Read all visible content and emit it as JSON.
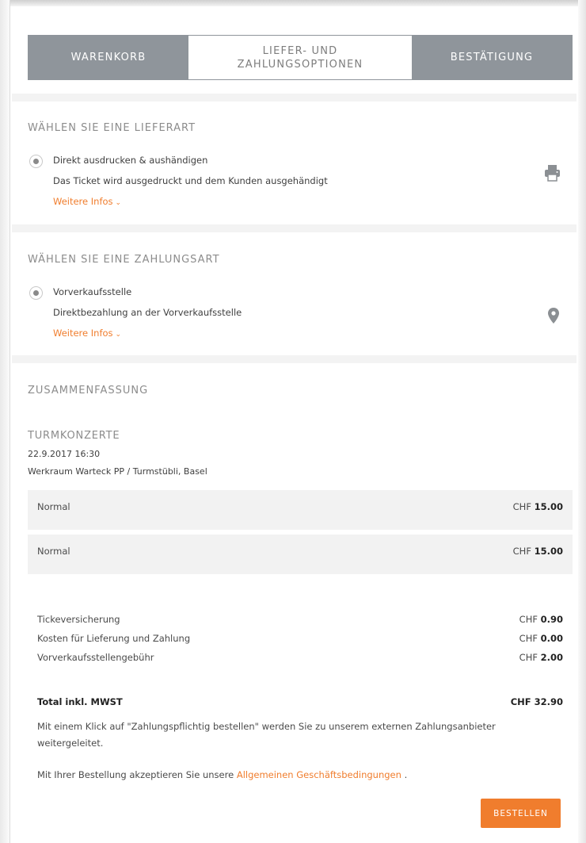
{
  "stepper": {
    "steps": [
      {
        "label": "WARENKORB",
        "active": false
      },
      {
        "label": "LIEFER- UND ZAHLUNGSOPTIONEN",
        "active": true
      },
      {
        "label": "BESTÄTIGUNG",
        "active": false
      }
    ]
  },
  "delivery": {
    "title": "WÄHLEN SIE EINE LIEFERART",
    "option_title": "Direkt ausdrucken & aushändigen",
    "option_desc": "Das Ticket wird ausgedruckt und dem Kunden ausgehändigt",
    "more_info": "Weitere Infos",
    "icon": "printer-icon"
  },
  "payment": {
    "title": "WÄHLEN SIE EINE ZAHLUNGSART",
    "option_title": "Vorverkaufsstelle",
    "option_desc": "Direktbezahlung an der Vorverkaufsstelle",
    "more_info": "Weitere Infos",
    "icon": "map-pin-icon"
  },
  "summary": {
    "title": "ZUSAMMENFASSUNG",
    "event": {
      "name": "TURMKONZERTE",
      "datetime": "22.9.2017 16:30",
      "venue": "Werkraum Warteck PP / Turmstübli, Basel"
    },
    "tickets": [
      {
        "label": "Normal",
        "currency": "CHF",
        "amount": "15.00"
      },
      {
        "label": "Normal",
        "currency": "CHF",
        "amount": "15.00"
      }
    ],
    "fees": [
      {
        "label": "Tickeversicherung",
        "currency": "CHF",
        "amount": "0.90"
      },
      {
        "label": "Kosten für Lieferung und Zahlung",
        "currency": "CHF",
        "amount": "0.00"
      },
      {
        "label": "Vorverkaufsstellengebühr",
        "currency": "CHF",
        "amount": "2.00"
      }
    ],
    "total": {
      "label": "Total inkl. MWST",
      "value": "CHF 32.90"
    },
    "redirect_note": "Mit einem Klick auf \"Zahlungspflichtig bestellen\" werden Sie zu unserem externen Zahlungsanbieter weitergeleitet.",
    "terms_prefix": "Mit Ihrer Bestellung akzeptieren Sie unsere",
    "terms_link": "Allgemeinen Geschäftsbedingungen",
    "terms_suffix": " ."
  },
  "order_button": "BESTELLEN",
  "colors": {
    "accent": "#f07d2d",
    "stepper_inactive": "#8f959b",
    "panel_bg": "#f3f3f3"
  }
}
